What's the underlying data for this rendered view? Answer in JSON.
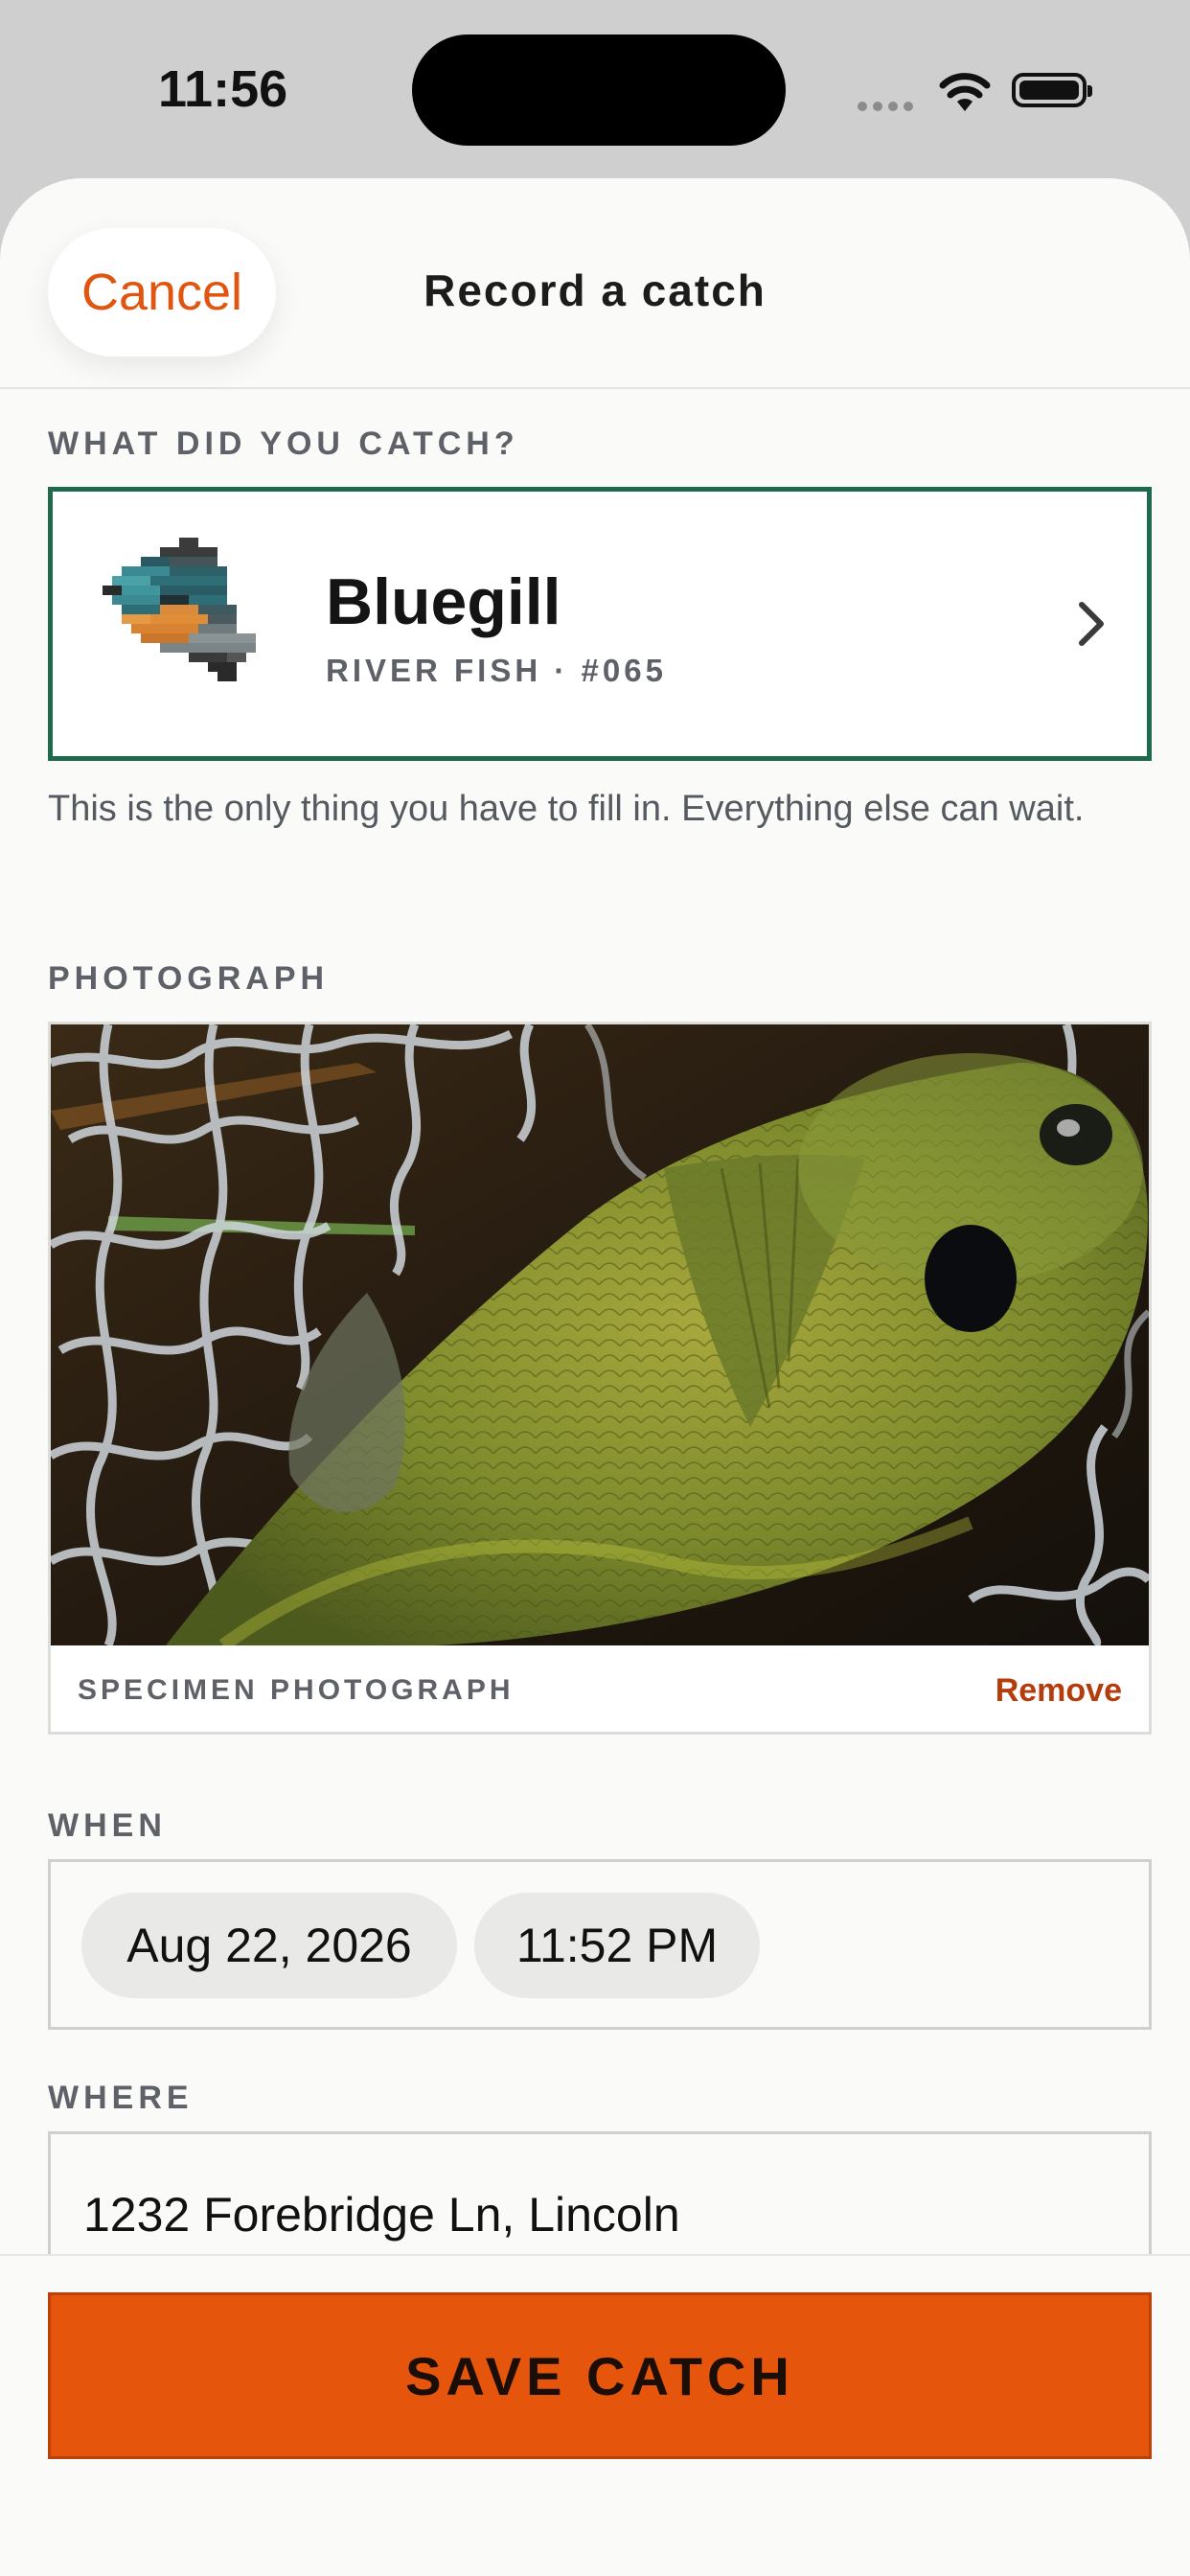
{
  "status_bar": {
    "time": "11:56"
  },
  "header": {
    "cancel_label": "Cancel",
    "title": "Record a catch"
  },
  "species_section": {
    "label": "WHAT DID YOU CATCH?",
    "species_name": "Bluegill",
    "species_meta": "RIVER FISH · #065",
    "helper_text": "This is the only thing you have to fill in. Everything else can wait."
  },
  "photo_section": {
    "label": "PHOTOGRAPH",
    "caption": "SPECIMEN PHOTOGRAPH",
    "remove_label": "Remove"
  },
  "when_section": {
    "label": "WHEN",
    "date": "Aug 22, 2026",
    "time": "11:52 PM"
  },
  "where_section": {
    "label": "WHERE",
    "value": "1232 Forebridge Ln, Lincoln"
  },
  "footer": {
    "save_label": "SAVE CATCH"
  },
  "colors": {
    "accent": "#e5550c",
    "species_border": "#1f6a4d",
    "remove": "#b53d0c"
  },
  "icons": [
    "wifi-icon",
    "battery-icon",
    "bluegill-sprite-icon",
    "chevron-right-icon"
  ]
}
